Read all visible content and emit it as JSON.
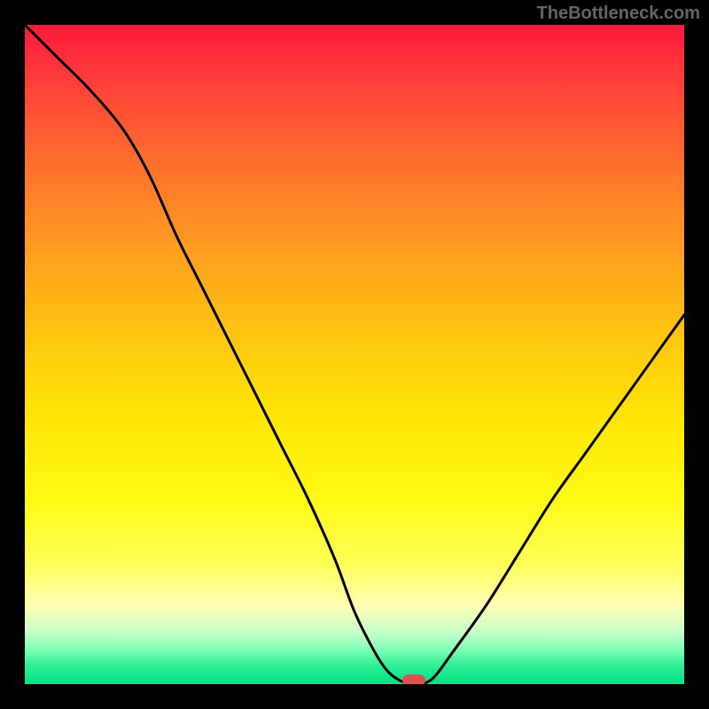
{
  "watermark": "TheBottleneck.com",
  "chart_data": {
    "type": "line",
    "title": "",
    "xlabel": "",
    "ylabel": "",
    "xlim": [
      0,
      100
    ],
    "ylim": [
      0,
      100
    ],
    "series": [
      {
        "name": "bottleneck-curve",
        "x": [
          0,
          5,
          10,
          15,
          19,
          23,
          27,
          31,
          35,
          39,
          43,
          47,
          50,
          53,
          55,
          57,
          59,
          60,
          62,
          65,
          70,
          75,
          80,
          85,
          90,
          95,
          100
        ],
        "y": [
          100,
          95,
          90,
          84,
          77,
          68,
          60,
          52,
          44,
          36,
          28,
          19,
          11,
          5,
          2,
          0.5,
          0,
          0,
          1,
          5,
          12,
          20,
          28,
          35,
          42,
          49,
          56
        ]
      }
    ],
    "marker": {
      "x": 59,
      "y": 0.5,
      "color": "#E05050"
    },
    "gradient_stops": [
      {
        "pos": 0,
        "color": "rgb(255,25,62)"
      },
      {
        "pos": 10,
        "color": "rgb(255,68,56)"
      },
      {
        "pos": 22,
        "color": "rgb(255,115,45)"
      },
      {
        "pos": 35,
        "color": "rgb(255,160,30)"
      },
      {
        "pos": 48,
        "color": "rgb(255,200,15)"
      },
      {
        "pos": 60,
        "color": "rgb(255,230,5)"
      },
      {
        "pos": 72,
        "color": "rgb(255,250,20)"
      },
      {
        "pos": 82,
        "color": "rgb(255,255,90)"
      },
      {
        "pos": 88,
        "color": "rgb(255,255,180)"
      },
      {
        "pos": 92,
        "color": "rgb(200,255,200)"
      },
      {
        "pos": 95,
        "color": "rgb(120,255,180)"
      },
      {
        "pos": 97,
        "color": "rgb(50,240,150)"
      },
      {
        "pos": 100,
        "color": "rgb(0,225,130)"
      }
    ]
  }
}
